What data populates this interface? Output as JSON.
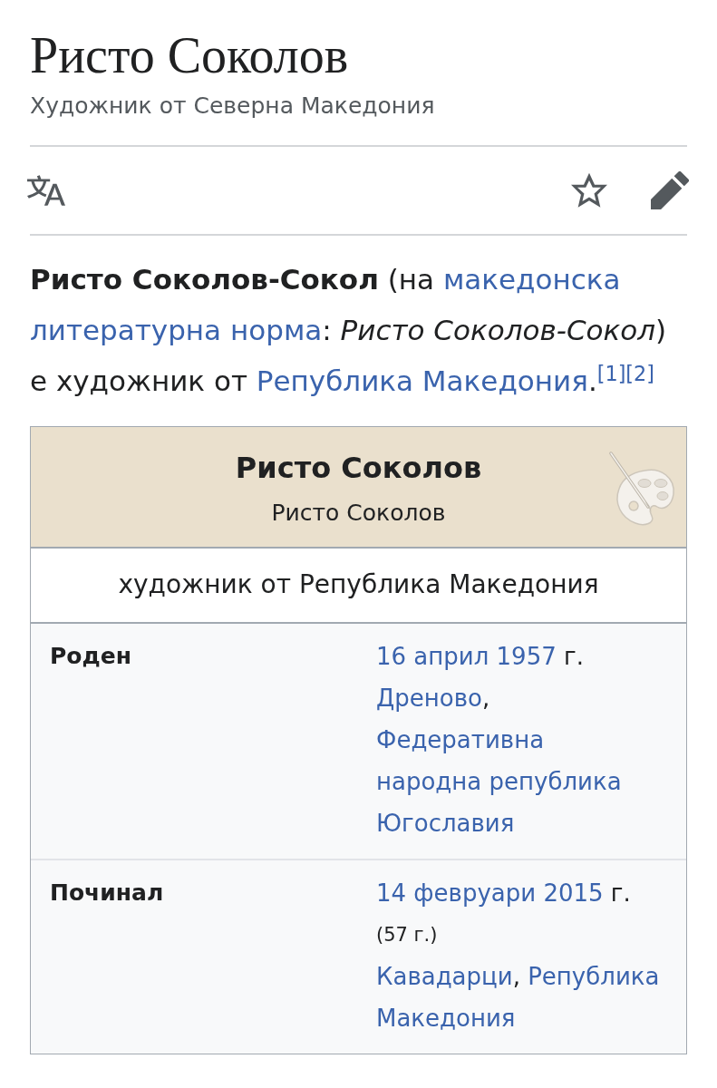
{
  "page": {
    "title": "Ристо Соколов",
    "description": "Художник от Северна Македония"
  },
  "lead": [
    {
      "kind": "bold",
      "text": "Ристо Соколов-Сокол"
    },
    {
      "kind": "text",
      "text": " (на "
    },
    {
      "kind": "link",
      "text": "македонска"
    },
    {
      "kind": "link",
      "text": "литературна норма"
    },
    {
      "kind": "text",
      "text": ": "
    },
    {
      "kind": "italic",
      "text": "Ристо Соколов-Сокол"
    },
    {
      "kind": "text",
      "text": ") е художник от "
    },
    {
      "kind": "link",
      "text": "Република Македония"
    },
    {
      "kind": "text",
      "text": "."
    },
    {
      "kind": "ref",
      "text": "[1]"
    },
    {
      "kind": "ref",
      "text": "[2]"
    }
  ],
  "infobox": {
    "title": "Ристо Соколов",
    "native_name": "Ристо Соколов",
    "caption": "художник от Република Македония",
    "rows": [
      {
        "label": "Роден",
        "value": [
          {
            "kind": "link",
            "text": "16 април 1957"
          },
          {
            "kind": "text",
            "text": " г. "
          },
          {
            "kind": "link",
            "text": "Дреново"
          },
          {
            "kind": "text",
            "text": ", "
          },
          {
            "kind": "link",
            "text": "Федеративна"
          },
          {
            "kind": "link",
            "text": "народна република"
          },
          {
            "kind": "link",
            "text": "Югославия"
          }
        ]
      },
      {
        "label": "Починал",
        "value": [
          {
            "kind": "link",
            "text": "14 февруари 2015"
          },
          {
            "kind": "text",
            "text": " г. "
          },
          {
            "kind": "age",
            "text": "(57 г.)"
          },
          {
            "kind": "link",
            "text": "Кавадарци"
          },
          {
            "kind": "text",
            "text": ", "
          },
          {
            "kind": "link",
            "text": "Република"
          },
          {
            "kind": "link",
            "text": "Македония"
          }
        ]
      }
    ]
  }
}
